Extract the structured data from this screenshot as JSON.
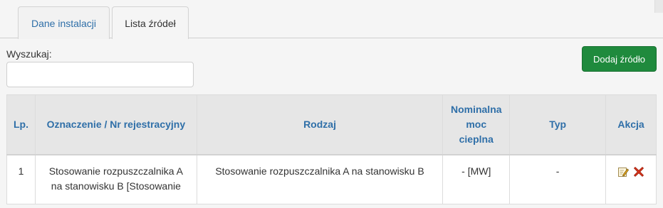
{
  "tabs": [
    {
      "label": "Dane instalacji"
    },
    {
      "label": "Lista źródeł"
    }
  ],
  "search": {
    "label": "Wyszukaj:",
    "value": "",
    "placeholder": ""
  },
  "add_button": {
    "label": "Dodaj źródło"
  },
  "table": {
    "headers": {
      "lp": "Lp.",
      "oznaczenie": "Oznaczenie / Nr rejestracyjny",
      "rodzaj": "Rodzaj",
      "moc": "Nominalna moc cieplna",
      "typ": "Typ",
      "akcja": "Akcja"
    },
    "rows": [
      {
        "lp": "1",
        "oznaczenie": "Stosowanie rozpuszczalnika A na stanowisku B [Stosowanie",
        "rodzaj": "Stosowanie rozpuszczalnika A na stanowisku B",
        "moc": "- [MW]",
        "typ": "-"
      }
    ]
  },
  "icons": {
    "edit": "edit-icon",
    "delete": "delete-icon"
  },
  "colors": {
    "accent": "#2f6fa8",
    "add_button": "#1f8a3d",
    "delete": "#d9351c"
  }
}
